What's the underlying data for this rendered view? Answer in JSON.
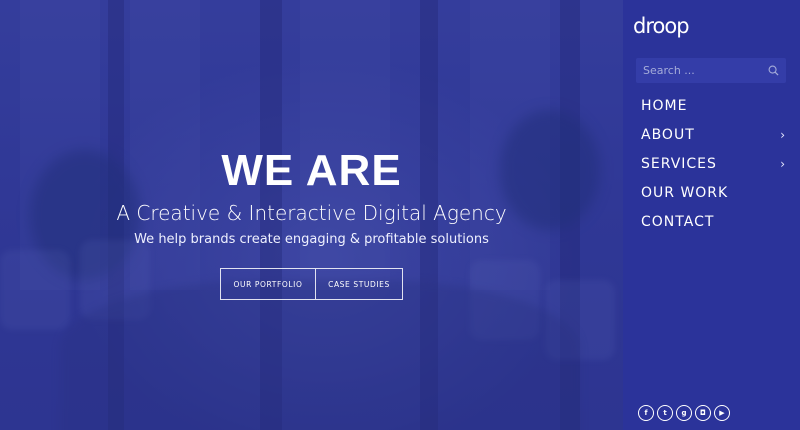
{
  "hero": {
    "title": "WE ARE",
    "subtitle": "A Creative & Interactive Digital Agency",
    "tagline": "We help brands create engaging & profitable solutions",
    "buttons": {
      "portfolio": "OUR PORTFOLIO",
      "case_studies": "CASE STUDIES"
    }
  },
  "sidebar": {
    "logo": "droop",
    "search": {
      "placeholder": "Search ..."
    },
    "nav": [
      {
        "label": "HOME",
        "has_submenu": false
      },
      {
        "label": "ABOUT",
        "has_submenu": true,
        "chevron": "›"
      },
      {
        "label": "SERVICES",
        "has_submenu": true,
        "chevron": "›"
      },
      {
        "label": "OUR WORK",
        "has_submenu": false
      },
      {
        "label": "CONTACT",
        "has_submenu": false
      }
    ],
    "social": [
      {
        "icon": "facebook-icon",
        "glyph": "f"
      },
      {
        "icon": "twitter-icon",
        "glyph": "t"
      },
      {
        "icon": "google-plus-icon",
        "glyph": "g"
      },
      {
        "icon": "instagram-icon",
        "glyph": "◘"
      },
      {
        "icon": "youtube-icon",
        "glyph": "▶"
      }
    ]
  },
  "colors": {
    "sidebar_bg": "#2b339a",
    "hero_overlay": "#333b97",
    "text": "#ffffff"
  }
}
